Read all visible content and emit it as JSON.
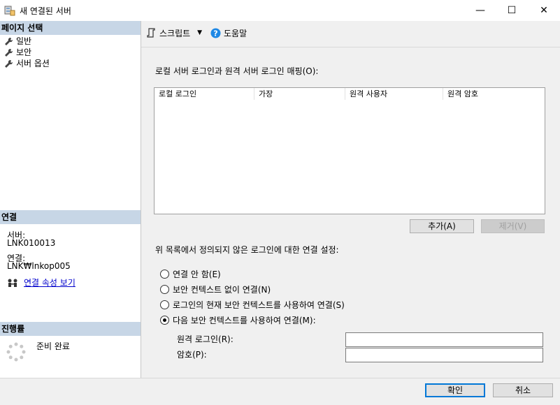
{
  "window": {
    "title": "새 연결된 서버",
    "minimize": "—",
    "maximize": "☐",
    "close": "✕"
  },
  "left_pane": {
    "page_select_header": "페이지 선택",
    "pages": [
      "일반",
      "보안",
      "서버 옵션"
    ],
    "connection_header": "연결",
    "server_label": "서버:",
    "server_value": "LNK010013",
    "connection_label": "연결:",
    "connection_value": "LNK₩lnkop005",
    "view_props_link": "연결 속성 보기",
    "progress_header": "진행률",
    "progress_status": "준비 완료"
  },
  "toolbar": {
    "script_label": "스크립트",
    "help_label": "도움말"
  },
  "main": {
    "mapping_label": "로컬 서버 로그인과 원격 서버 로그인 매핑(O):",
    "grid_columns": [
      "로컬 로그인",
      "가장",
      "원격 사용자",
      "원격 암호"
    ],
    "add_button": "추가(A)",
    "remove_button": "제거(V)",
    "undefined_label": "위 목록에서 정의되지 않은 로그인에 대한 연결 설정:",
    "options": [
      {
        "label": "연결 안 함(E)",
        "checked": false
      },
      {
        "label": "보안 컨텍스트 없이 연결(N)",
        "checked": false
      },
      {
        "label": "로그인의 현재 보안 컨텍스트를 사용하여 연결(S)",
        "checked": false
      },
      {
        "label": "다음 보안 컨텍스트를 사용하여 연결(M):",
        "checked": true
      }
    ],
    "remote_login_label": "원격 로그인(R):",
    "remote_login_value": "",
    "password_label": "암호(P):",
    "password_value": ""
  },
  "footer": {
    "ok_button": "확인",
    "cancel_button": "취소"
  },
  "colors": {
    "section_header": "#c7d6e6",
    "link": "#0000cc",
    "help_icon": "#1e88e5"
  }
}
